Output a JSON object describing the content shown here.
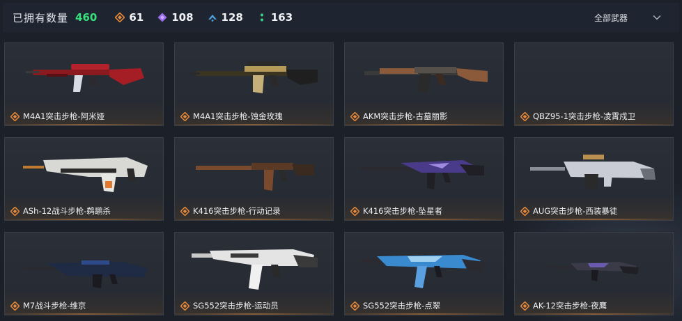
{
  "header": {
    "owned_label": "已拥有数量",
    "owned_count": "460",
    "stats": [
      {
        "icon": "orange-diamond-icon",
        "value": "61",
        "color": "#e88a3a"
      },
      {
        "icon": "purple-diamond-icon",
        "value": "108",
        "color": "#9b6cf0"
      },
      {
        "icon": "blue-chevron-icon",
        "value": "128",
        "color": "#4fa3e0"
      },
      {
        "icon": "green-dots-icon",
        "value": "163",
        "color": "#39d38a"
      }
    ],
    "filter_label": "全部武器"
  },
  "colors": {
    "owned_count": "#38e07b",
    "rarity_orange": "#e88a3a",
    "card_bg": "#2a2f38",
    "page_bg": "#1b2029"
  },
  "weapons": [
    {
      "name": "M4A1突击步枪-阿米娅",
      "rarity": "orange-diamond-icon",
      "palette": "#b3222a"
    },
    {
      "name": "M4A1突击步枪-蚀金玫瑰",
      "rarity": "orange-diamond-icon",
      "palette": "#b59a5a"
    },
    {
      "name": "AKM突击步枪-古墓丽影",
      "rarity": "orange-diamond-icon",
      "palette": "#8a5a3a"
    },
    {
      "name": "QBZ95-1突击步枪-凌霄戍卫",
      "rarity": "orange-diamond-icon",
      "palette": ""
    },
    {
      "name": "ASh-12战斗步枪-鹈鹕杀",
      "rarity": "orange-diamond-icon",
      "palette": "#d8d8d4"
    },
    {
      "name": "K416突击步枪-行动记录",
      "rarity": "orange-diamond-icon",
      "palette": "#7a4a2e"
    },
    {
      "name": "K416突击步枪-坠星者",
      "rarity": "orange-diamond-icon",
      "palette": "#4a3a8a"
    },
    {
      "name": "AUG突击步枪-西装暴徒",
      "rarity": "orange-diamond-icon",
      "palette": "#c9ccd4"
    },
    {
      "name": "M7战斗步枪-维京",
      "rarity": "orange-diamond-icon",
      "palette": "#2f4a8a"
    },
    {
      "name": "SG552突击步枪-运动员",
      "rarity": "orange-diamond-icon",
      "palette": "#e4e4e4"
    },
    {
      "name": "SG552突击步枪-点翠",
      "rarity": "orange-diamond-icon",
      "palette": "#3a8ad0"
    },
    {
      "name": "AK-12突击步枪-夜鹰",
      "rarity": "orange-diamond-icon",
      "palette": "#6a5ab0"
    }
  ]
}
